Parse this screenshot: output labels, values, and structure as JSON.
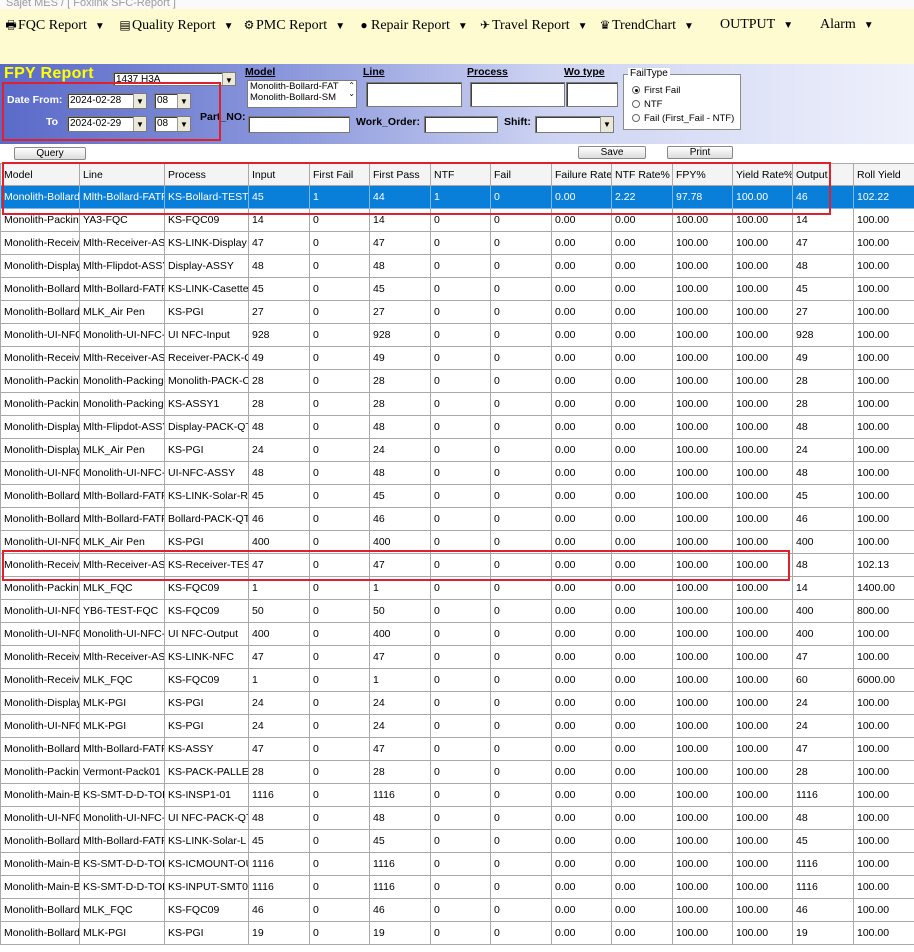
{
  "window": {
    "title": "Sajet MES / [ Foxlink SFC-Report ]"
  },
  "menu": [
    {
      "label": "FQC Report",
      "icon": "printer-icon"
    },
    {
      "label": "Quality Report",
      "icon": "report-icon"
    },
    {
      "label": "PMC Report",
      "icon": "gear-icon"
    },
    {
      "label": "Repair Report",
      "icon": "repair-icon"
    },
    {
      "label": "Travel Report",
      "icon": "travel-icon"
    },
    {
      "label": "TrendChart",
      "icon": "trendchart-icon"
    },
    {
      "label": "OUTPUT",
      "icon": ""
    },
    {
      "label": "Alarm",
      "icon": ""
    }
  ],
  "criteria": {
    "title": "FPY Report",
    "factory_value": "1437 H3A",
    "date_from_label": "Date From:",
    "to_label": "To",
    "date_from": "2024-02-28",
    "hour_from": "08",
    "date_to": "2024-02-29",
    "hour_to": "08",
    "model_label": "Model",
    "model_items": [
      "Monolith-Bollard-FAT",
      "Monolith-Bollard-SM"
    ],
    "line_label": "Line",
    "process_label": "Process",
    "wo_type_label": "Wo type",
    "part_no_label": "Part_NO:",
    "work_order_label": "Work_Order:",
    "shift_label": "Shift:",
    "failtype_legend": "FailType",
    "failtype_options": [
      "First Fail",
      "NTF",
      "Fail (First_Fail - NTF)"
    ],
    "failtype_selected": 0
  },
  "buttons": {
    "query": "Query",
    "save": "Save",
    "print": "Print"
  },
  "table": {
    "columns": [
      "Model",
      "Line",
      "Process",
      "Input",
      "First Fail",
      "First Pass",
      "NTF",
      "Fail",
      "Failure Rate%",
      "NTF Rate%",
      "FPY%",
      "Yield Rate%",
      "Output",
      "Roll Yield"
    ],
    "selected_row": 0,
    "rows": [
      [
        "Monolith-Bollard-",
        "Mlth-Bollard-FATP",
        "KS-Bollard-TEST",
        "45",
        "1",
        "44",
        "1",
        "0",
        "0.00",
        "2.22",
        "97.78",
        "100.00",
        "46",
        "102.22"
      ],
      [
        "Monolith-Packing",
        "YA3-FQC",
        "KS-FQC09",
        "14",
        "0",
        "14",
        "0",
        "0",
        "0.00",
        "0.00",
        "100.00",
        "100.00",
        "14",
        "100.00"
      ],
      [
        "Monolith-Receiv",
        "Mlth-Receiver-ASS",
        "KS-LINK-Display",
        "47",
        "0",
        "47",
        "0",
        "0",
        "0.00",
        "0.00",
        "100.00",
        "100.00",
        "47",
        "100.00"
      ],
      [
        "Monolith-Display",
        "Mlth-Flipdot-ASSY",
        "Display-ASSY",
        "48",
        "0",
        "48",
        "0",
        "0",
        "0.00",
        "0.00",
        "100.00",
        "100.00",
        "48",
        "100.00"
      ],
      [
        "Monolith-Bollard-",
        "Mlth-Bollard-FATP",
        "KS-LINK-Casette",
        "45",
        "0",
        "45",
        "0",
        "0",
        "0.00",
        "0.00",
        "100.00",
        "100.00",
        "45",
        "100.00"
      ],
      [
        "Monolith-Bollard-",
        "MLK_Air Pen",
        "KS-PGI",
        "27",
        "0",
        "27",
        "0",
        "0",
        "0.00",
        "0.00",
        "100.00",
        "100.00",
        "27",
        "100.00"
      ],
      [
        "Monolith-UI-NFC",
        "Monolith-UI-NFC-T",
        "UI NFC-Input",
        "928",
        "0",
        "928",
        "0",
        "0",
        "0.00",
        "0.00",
        "100.00",
        "100.00",
        "928",
        "100.00"
      ],
      [
        "Monolith-Receiv",
        "Mlth-Receiver-ASS",
        "Receiver-PACK-QT",
        "49",
        "0",
        "49",
        "0",
        "0",
        "0.00",
        "0.00",
        "100.00",
        "100.00",
        "49",
        "100.00"
      ],
      [
        "Monolith-Packing",
        "Monolith-Packing",
        "Monolith-PACK-CA",
        "28",
        "0",
        "28",
        "0",
        "0",
        "0.00",
        "0.00",
        "100.00",
        "100.00",
        "28",
        "100.00"
      ],
      [
        "Monolith-Packing",
        "Monolith-Packing",
        "KS-ASSY1",
        "28",
        "0",
        "28",
        "0",
        "0",
        "0.00",
        "0.00",
        "100.00",
        "100.00",
        "28",
        "100.00"
      ],
      [
        "Monolith-Display",
        "Mlth-Flipdot-ASSY",
        "Display-PACK-QTY",
        "48",
        "0",
        "48",
        "0",
        "0",
        "0.00",
        "0.00",
        "100.00",
        "100.00",
        "48",
        "100.00"
      ],
      [
        "Monolith-Display",
        "MLK_Air Pen",
        "KS-PGI",
        "24",
        "0",
        "24",
        "0",
        "0",
        "0.00",
        "0.00",
        "100.00",
        "100.00",
        "24",
        "100.00"
      ],
      [
        "Monolith-UI-NFC",
        "Monolith-UI-NFC-A",
        "UI-NFC-ASSY",
        "48",
        "0",
        "48",
        "0",
        "0",
        "0.00",
        "0.00",
        "100.00",
        "100.00",
        "48",
        "100.00"
      ],
      [
        "Monolith-Bollard-",
        "Mlth-Bollard-FATP",
        "KS-LINK-Solar-R",
        "45",
        "0",
        "45",
        "0",
        "0",
        "0.00",
        "0.00",
        "100.00",
        "100.00",
        "45",
        "100.00"
      ],
      [
        "Monolith-Bollard-",
        "Mlth-Bollard-FATP",
        "Bollard-PACK-QTY",
        "46",
        "0",
        "46",
        "0",
        "0",
        "0.00",
        "0.00",
        "100.00",
        "100.00",
        "46",
        "100.00"
      ],
      [
        "Monolith-UI-NFC",
        "MLK_Air Pen",
        "KS-PGI",
        "400",
        "0",
        "400",
        "0",
        "0",
        "0.00",
        "0.00",
        "100.00",
        "100.00",
        "400",
        "100.00"
      ],
      [
        "Monolith-Receiv",
        "Mlth-Receiver-ASS",
        "KS-Receiver-TEST",
        "47",
        "0",
        "47",
        "0",
        "0",
        "0.00",
        "0.00",
        "100.00",
        "100.00",
        "48",
        "102.13"
      ],
      [
        "Monolith-Packing",
        "MLK_FQC",
        "KS-FQC09",
        "1",
        "0",
        "1",
        "0",
        "0",
        "0.00",
        "0.00",
        "100.00",
        "100.00",
        "14",
        "1400.00"
      ],
      [
        "Monolith-UI-NFC",
        "YB6-TEST-FQC",
        "KS-FQC09",
        "50",
        "0",
        "50",
        "0",
        "0",
        "0.00",
        "0.00",
        "100.00",
        "100.00",
        "400",
        "800.00"
      ],
      [
        "Monolith-UI-NFC",
        "Monolith-UI-NFC-T",
        "UI NFC-Output",
        "400",
        "0",
        "400",
        "0",
        "0",
        "0.00",
        "0.00",
        "100.00",
        "100.00",
        "400",
        "100.00"
      ],
      [
        "Monolith-Receiv",
        "Mlth-Receiver-ASS",
        "KS-LINK-NFC",
        "47",
        "0",
        "47",
        "0",
        "0",
        "0.00",
        "0.00",
        "100.00",
        "100.00",
        "47",
        "100.00"
      ],
      [
        "Monolith-Receiv",
        "MLK_FQC",
        "KS-FQC09",
        "1",
        "0",
        "1",
        "0",
        "0",
        "0.00",
        "0.00",
        "100.00",
        "100.00",
        "60",
        "6000.00"
      ],
      [
        "Monolith-Display",
        "MLK-PGI",
        "KS-PGI",
        "24",
        "0",
        "24",
        "0",
        "0",
        "0.00",
        "0.00",
        "100.00",
        "100.00",
        "24",
        "100.00"
      ],
      [
        "Monolith-UI-NFC",
        "MLK-PGI",
        "KS-PGI",
        "24",
        "0",
        "24",
        "0",
        "0",
        "0.00",
        "0.00",
        "100.00",
        "100.00",
        "24",
        "100.00"
      ],
      [
        "Monolith-Bollard-",
        "Mlth-Bollard-FATP",
        "KS-ASSY",
        "47",
        "0",
        "47",
        "0",
        "0",
        "0.00",
        "0.00",
        "100.00",
        "100.00",
        "47",
        "100.00"
      ],
      [
        "Monolith-Packing",
        "Vermont-Pack01",
        "KS-PACK-PALLET",
        "28",
        "0",
        "28",
        "0",
        "0",
        "0.00",
        "0.00",
        "100.00",
        "100.00",
        "28",
        "100.00"
      ],
      [
        "Monolith-Main-B",
        "KS-SMT-D-D-TOP",
        "KS-INSP1-01",
        "1116",
        "0",
        "1116",
        "0",
        "0",
        "0.00",
        "0.00",
        "100.00",
        "100.00",
        "1116",
        "100.00"
      ],
      [
        "Monolith-UI-NFC",
        "Monolith-UI-NFC-A",
        "UI NFC-PACK-QTY",
        "48",
        "0",
        "48",
        "0",
        "0",
        "0.00",
        "0.00",
        "100.00",
        "100.00",
        "48",
        "100.00"
      ],
      [
        "Monolith-Bollard-",
        "Mlth-Bollard-FATP",
        "KS-LINK-Solar-L",
        "45",
        "0",
        "45",
        "0",
        "0",
        "0.00",
        "0.00",
        "100.00",
        "100.00",
        "45",
        "100.00"
      ],
      [
        "Monolith-Main-B",
        "KS-SMT-D-D-TOP",
        "KS-ICMOUNT-OUT",
        "1116",
        "0",
        "1116",
        "0",
        "0",
        "0.00",
        "0.00",
        "100.00",
        "100.00",
        "1116",
        "100.00"
      ],
      [
        "Monolith-Main-B",
        "KS-SMT-D-D-TOP",
        "KS-INPUT-SMT01",
        "1116",
        "0",
        "1116",
        "0",
        "0",
        "0.00",
        "0.00",
        "100.00",
        "100.00",
        "1116",
        "100.00"
      ],
      [
        "Monolith-Bollard-",
        "MLK_FQC",
        "KS-FQC09",
        "46",
        "0",
        "46",
        "0",
        "0",
        "0.00",
        "0.00",
        "100.00",
        "100.00",
        "46",
        "100.00"
      ],
      [
        "Monolith-Bollard-",
        "MLK-PGI",
        "KS-PGI",
        "19",
        "0",
        "19",
        "0",
        "0",
        "0.00",
        "0.00",
        "100.00",
        "100.00",
        "19",
        "100.00"
      ]
    ]
  },
  "colors": {
    "menubar": "#fdfbcf",
    "selection": "#0a7fd9",
    "highlight_box": "#e0202c",
    "title_text": "#ffff00"
  }
}
